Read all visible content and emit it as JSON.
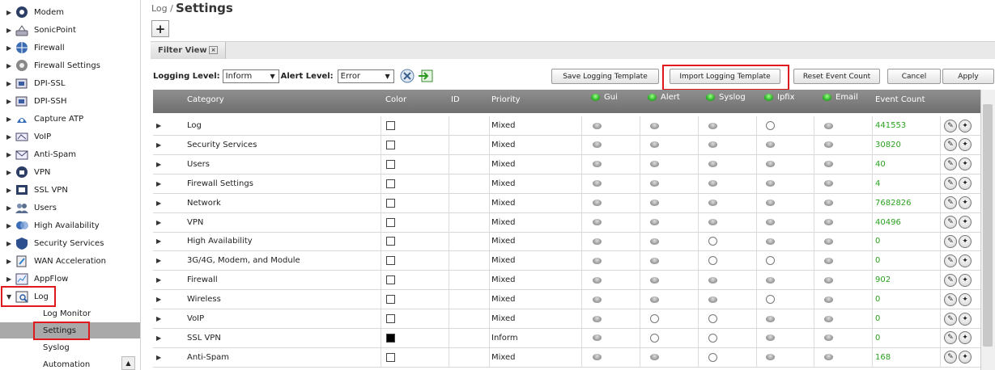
{
  "sidebar": {
    "items": [
      {
        "label": "Modem",
        "icon": "modem-icon",
        "arrow": "▶"
      },
      {
        "label": "SonicPoint",
        "icon": "sonicpoint-icon",
        "arrow": "▶"
      },
      {
        "label": "Firewall",
        "icon": "firewall-icon",
        "arrow": "▶"
      },
      {
        "label": "Firewall Settings",
        "icon": "firewall-settings-icon",
        "arrow": "▶"
      },
      {
        "label": "DPI-SSL",
        "icon": "dpi-ssl-icon",
        "arrow": "▶"
      },
      {
        "label": "DPI-SSH",
        "icon": "dpi-ssh-icon",
        "arrow": "▶"
      },
      {
        "label": "Capture ATP",
        "icon": "capture-atp-icon",
        "arrow": "▶"
      },
      {
        "label": "VoIP",
        "icon": "voip-icon",
        "arrow": "▶"
      },
      {
        "label": "Anti-Spam",
        "icon": "anti-spam-icon",
        "arrow": "▶"
      },
      {
        "label": "VPN",
        "icon": "vpn-icon",
        "arrow": "▶"
      },
      {
        "label": "SSL VPN",
        "icon": "ssl-vpn-icon",
        "arrow": "▶"
      },
      {
        "label": "Users",
        "icon": "users-icon",
        "arrow": "▶"
      },
      {
        "label": "High Availability",
        "icon": "high-availability-icon",
        "arrow": "▶"
      },
      {
        "label": "Security Services",
        "icon": "security-services-icon",
        "arrow": "▶"
      },
      {
        "label": "WAN Acceleration",
        "icon": "wan-acceleration-icon",
        "arrow": "▶"
      },
      {
        "label": "AppFlow",
        "icon": "appflow-icon",
        "arrow": "▶"
      },
      {
        "label": "Log",
        "icon": "log-icon",
        "arrow": "▼"
      }
    ],
    "sub_items": [
      {
        "label": "Log Monitor"
      },
      {
        "label": "Settings"
      },
      {
        "label": "Syslog"
      },
      {
        "label": "Automation"
      }
    ]
  },
  "header": {
    "breadcrumb": "Log /",
    "title": "Settings",
    "add_button": "+"
  },
  "filter": {
    "tab_label": "Filter View",
    "close_glyph": "×"
  },
  "controls": {
    "logging_level_label": "Logging Level:",
    "logging_level_value": "Inform",
    "alert_level_label": "Alert Level:",
    "alert_level_value": "Error",
    "caret": "▼"
  },
  "buttons": {
    "save_template": "Save Logging Template",
    "import_template": "Import Logging Template",
    "reset_count": "Reset Event Count",
    "cancel": "Cancel",
    "apply": "Apply"
  },
  "table": {
    "headers": {
      "category": "Category",
      "color": "Color",
      "id": "ID",
      "priority": "Priority",
      "gui": "Gui",
      "alert": "Alert",
      "syslog": "Syslog",
      "ipfix": "Ipfix",
      "email": "Email",
      "event_count": "Event Count"
    },
    "rows": [
      {
        "category": "Log",
        "color_filled": false,
        "priority": "Mixed",
        "gui": "on",
        "alert": "on",
        "syslog": "on",
        "ipfix": "off",
        "email": "on",
        "count": "441553"
      },
      {
        "category": "Security Services",
        "color_filled": false,
        "priority": "Mixed",
        "gui": "on",
        "alert": "on",
        "syslog": "on",
        "ipfix": "on",
        "email": "on",
        "count": "30820"
      },
      {
        "category": "Users",
        "color_filled": false,
        "priority": "Mixed",
        "gui": "on",
        "alert": "on",
        "syslog": "on",
        "ipfix": "on",
        "email": "on",
        "count": "40"
      },
      {
        "category": "Firewall Settings",
        "color_filled": false,
        "priority": "Mixed",
        "gui": "on",
        "alert": "on",
        "syslog": "on",
        "ipfix": "on",
        "email": "on",
        "count": "4"
      },
      {
        "category": "Network",
        "color_filled": false,
        "priority": "Mixed",
        "gui": "on",
        "alert": "on",
        "syslog": "on",
        "ipfix": "on",
        "email": "on",
        "count": "7682826"
      },
      {
        "category": "VPN",
        "color_filled": false,
        "priority": "Mixed",
        "gui": "on",
        "alert": "on",
        "syslog": "on",
        "ipfix": "on",
        "email": "on",
        "count": "40496"
      },
      {
        "category": "High Availability",
        "color_filled": false,
        "priority": "Mixed",
        "gui": "on",
        "alert": "on",
        "syslog": "off",
        "ipfix": "on",
        "email": "on",
        "count": "0"
      },
      {
        "category": "3G/4G, Modem, and Module",
        "color_filled": false,
        "priority": "Mixed",
        "gui": "on",
        "alert": "on",
        "syslog": "off",
        "ipfix": "off",
        "email": "on",
        "count": "0"
      },
      {
        "category": "Firewall",
        "color_filled": false,
        "priority": "Mixed",
        "gui": "on",
        "alert": "on",
        "syslog": "on",
        "ipfix": "on",
        "email": "on",
        "count": "902"
      },
      {
        "category": "Wireless",
        "color_filled": false,
        "priority": "Mixed",
        "gui": "on",
        "alert": "on",
        "syslog": "on",
        "ipfix": "off",
        "email": "on",
        "count": "0"
      },
      {
        "category": "VoIP",
        "color_filled": false,
        "priority": "Mixed",
        "gui": "on",
        "alert": "off",
        "syslog": "off",
        "ipfix": "on",
        "email": "on",
        "count": "0"
      },
      {
        "category": "SSL VPN",
        "color_filled": true,
        "priority": "Inform",
        "gui": "on",
        "alert": "off",
        "syslog": "off",
        "ipfix": "on",
        "email": "on",
        "count": "0"
      },
      {
        "category": "Anti-Spam",
        "color_filled": false,
        "priority": "Mixed",
        "gui": "on",
        "alert": "on",
        "syslog": "off",
        "ipfix": "on",
        "email": "on",
        "count": "168"
      }
    ]
  },
  "colors": {
    "highlight_red": "#e0191c",
    "count_green": "#2aa21e",
    "header_gray": "#7f7f7f",
    "selected_gray": "#a9a9a9"
  }
}
